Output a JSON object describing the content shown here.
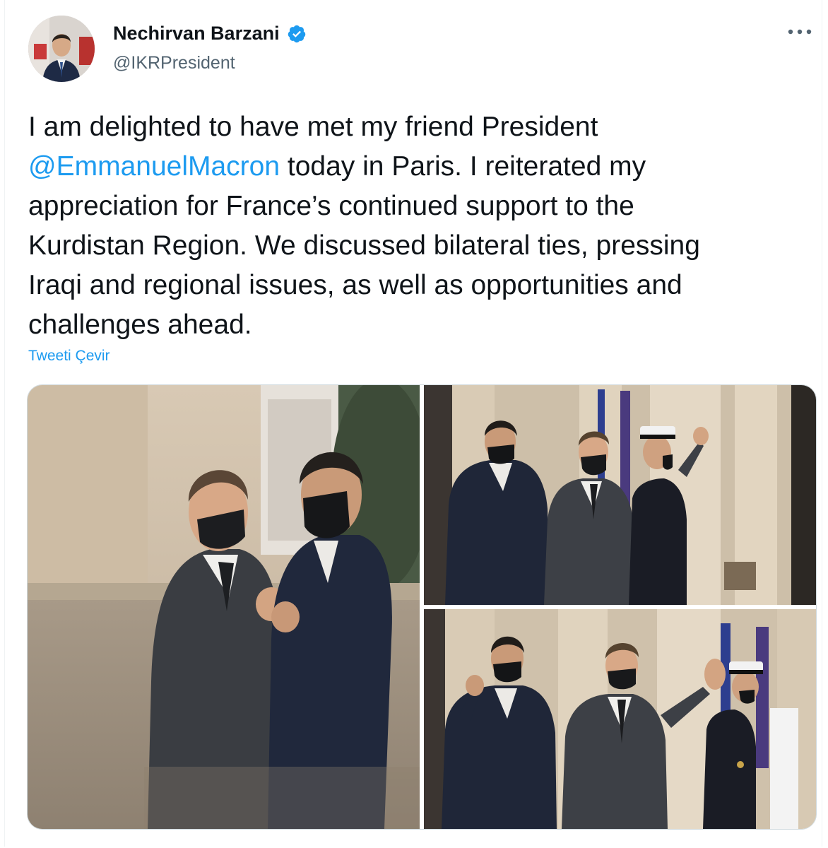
{
  "tweet": {
    "author_name": "Nechirvan Barzani",
    "author_handle": "@IKRPresident",
    "verified": true,
    "more_icon": "more-horizontal-icon",
    "text_before_mention": "I am delighted to have met my friend President",
    "mention": "@EmmanuelMacron",
    "text_after_mention": " today in Paris. I reiterated my\nappreciation for France’s continued support to the\nKurdistan Region. We discussed bilateral ties, pressing\nIraqi and regional issues, as well as  opportunities and\nchallenges ahead.",
    "translate_label": "Tweeti Çevir",
    "media": [
      {
        "id": "photo-elbow-bump"
      },
      {
        "id": "photo-thumbs-up"
      },
      {
        "id": "photo-waving"
      }
    ]
  },
  "colors": {
    "accent": "#1d9bf0",
    "text": "#0f1419",
    "secondary": "#536471"
  }
}
